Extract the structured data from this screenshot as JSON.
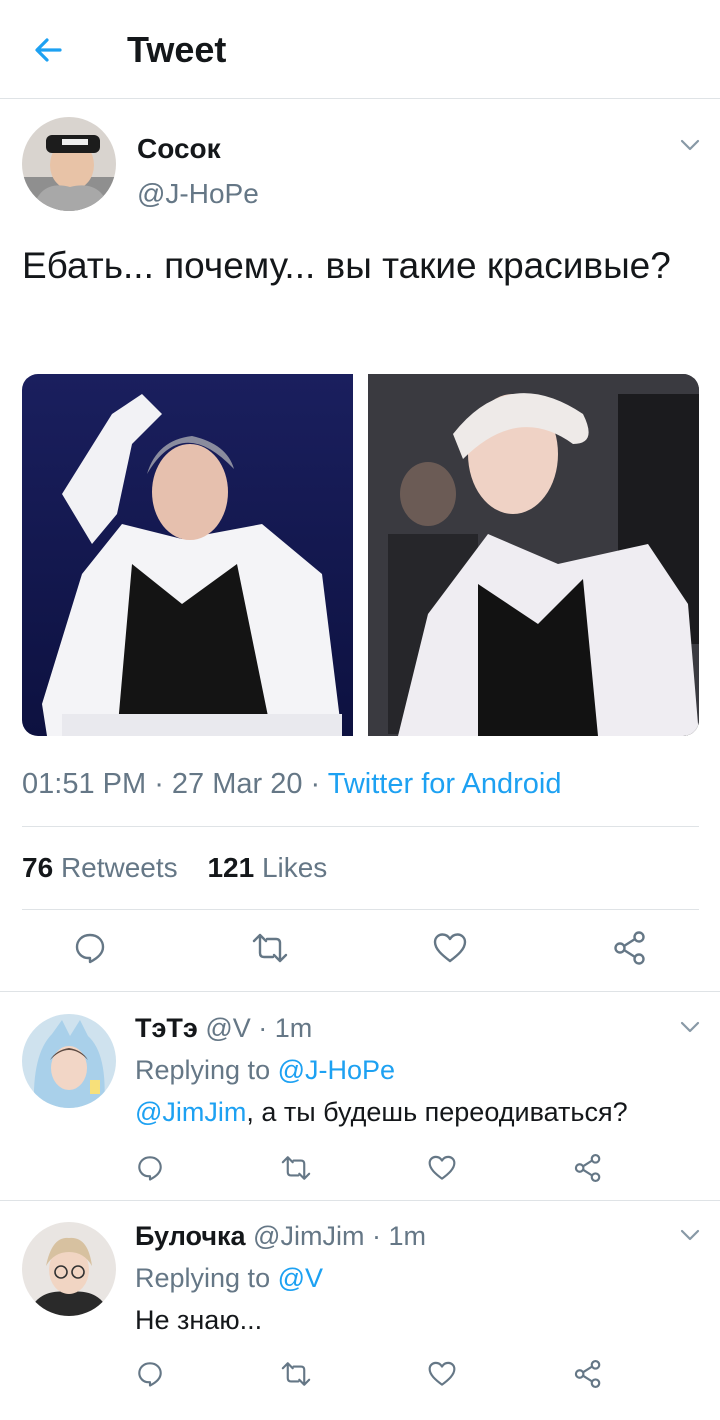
{
  "header": {
    "title": "Tweet",
    "back_icon": "arrow-left-icon"
  },
  "colors": {
    "accent": "#1da1f2",
    "muted": "#657786",
    "text": "#14171a",
    "divider": "#dfe3e6"
  },
  "tweet": {
    "display_name": "Сосок",
    "handle": "@J-HoPe",
    "text": "Ебать... почему... вы такие красивые?",
    "time": "01:51 PM",
    "sep1": " · ",
    "date": "27 Mar 20",
    "sep2": " · ",
    "source": "Twitter for Android",
    "retweets_count": "76",
    "retweets_label": "Retweets",
    "likes_count": "121",
    "likes_label": "Likes"
  },
  "replies": [
    {
      "display_name": "ТэТэ",
      "handle": "@V",
      "sep": " · ",
      "time": "1m",
      "replying_prefix": "Replying to ",
      "replying_to": "@J-HoPe",
      "mention": "@JimJim",
      "text": ", а ты будешь переодиваться?"
    },
    {
      "display_name": "Булочка",
      "handle": "@JimJim",
      "sep": " · ",
      "time": "1m",
      "replying_prefix": "Replying to ",
      "replying_to": "@V",
      "text": "Не знаю..."
    }
  ]
}
